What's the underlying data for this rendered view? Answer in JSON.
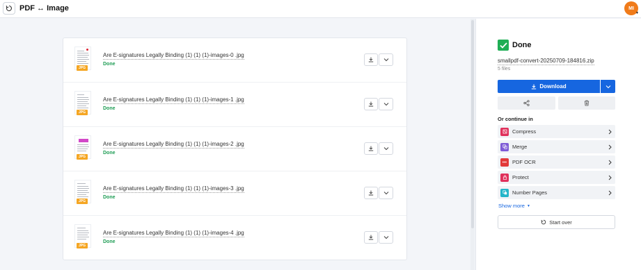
{
  "header": {
    "title": "PDF ↔ Image",
    "back_icon": "undo-icon",
    "avatar_initials": "MI",
    "avatar_color": "#f07b1a"
  },
  "files": [
    {
      "name": "Are E-signatures Legally Binding (1) (1) (1)-images-0 .jpg",
      "status": "Done",
      "badge": "JPG"
    },
    {
      "name": "Are E-signatures Legally Binding (1) (1) (1)-images-1 .jpg",
      "status": "Done",
      "badge": "JPG"
    },
    {
      "name": "Are E-signatures Legally Binding (1) (1) (1)-images-2 .jpg",
      "status": "Done",
      "badge": "JPG"
    },
    {
      "name": "Are E-signatures Legally Binding (1) (1) (1)-images-3 .jpg",
      "status": "Done",
      "badge": "JPG"
    },
    {
      "name": "Are E-signatures Legally Binding (1) (1) (1)-images-4 .jpg",
      "status": "Done",
      "badge": "JPG"
    }
  ],
  "panel": {
    "status_title": "Done",
    "zip_name": "smallpdf-convert-20250709-184816.zip",
    "file_count": "5 files",
    "download_label": "Download",
    "continue_label": "Or continue in",
    "tools": [
      {
        "label": "Compress",
        "icon": "compress-icon",
        "color": "#e0315b"
      },
      {
        "label": "Merge",
        "icon": "merge-icon",
        "color": "#7e5bd6"
      },
      {
        "label": "PDF OCR",
        "icon": "ocr-icon",
        "color": "#e23a3a"
      },
      {
        "label": "Protect",
        "icon": "lock-icon",
        "color": "#e0315b"
      },
      {
        "label": "Number Pages",
        "icon": "number-pages-icon",
        "color": "#23b5c9"
      }
    ],
    "show_more": "Show more",
    "start_over": "Start over"
  },
  "colors": {
    "accent": "#1666e0",
    "success": "#1f9d55",
    "jpg_badge": "#f5a623"
  }
}
